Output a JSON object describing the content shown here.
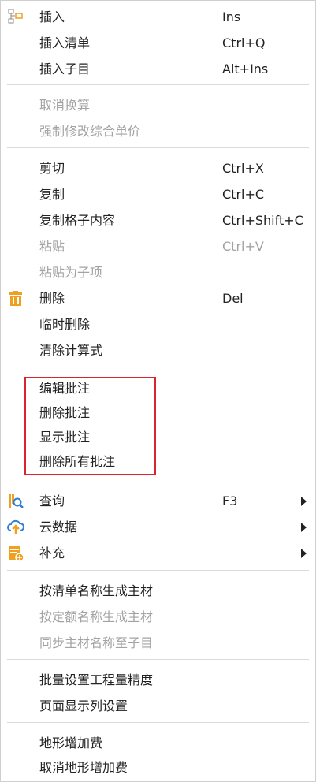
{
  "menu": {
    "insert": {
      "label": "插入",
      "shortcut": "Ins"
    },
    "insert_list": {
      "label": "插入清单",
      "shortcut": "Ctrl+Q"
    },
    "insert_child": {
      "label": "插入子目",
      "shortcut": "Alt+Ins"
    },
    "cancel_convert": {
      "label": "取消换算"
    },
    "force_modify_price": {
      "label": "强制修改综合单价"
    },
    "cut": {
      "label": "剪切",
      "shortcut": "Ctrl+X"
    },
    "copy": {
      "label": "复制",
      "shortcut": "Ctrl+C"
    },
    "copy_cell": {
      "label": "复制格子内容",
      "shortcut": "Ctrl+Shift+C"
    },
    "paste": {
      "label": "粘贴",
      "shortcut": "Ctrl+V"
    },
    "paste_as_child": {
      "label": "粘贴为子项"
    },
    "delete": {
      "label": "删除",
      "shortcut": "Del"
    },
    "temp_delete": {
      "label": "临时删除"
    },
    "clear_formula": {
      "label": "清除计算式"
    },
    "edit_note": {
      "label": "编辑批注"
    },
    "delete_note": {
      "label": "删除批注"
    },
    "show_note": {
      "label": "显示批注"
    },
    "delete_all_notes": {
      "label": "删除所有批注"
    },
    "query": {
      "label": "查询",
      "shortcut": "F3"
    },
    "cloud_data": {
      "label": "云数据"
    },
    "supplement": {
      "label": "补充"
    },
    "gen_main_by_list": {
      "label": "按清单名称生成主材"
    },
    "gen_main_by_quota": {
      "label": "按定额名称生成主材"
    },
    "sync_main_name": {
      "label": "同步主材名称至子目"
    },
    "batch_precision": {
      "label": "批量设置工程量精度"
    },
    "page_columns": {
      "label": "页面显示列设置"
    },
    "terrain_fee": {
      "label": "地形增加费"
    },
    "cancel_terrain_fee": {
      "label": "取消地形增加费"
    }
  },
  "colors": {
    "highlight_border": "#d9242f",
    "icon_orange": "#f0a020",
    "icon_blue": "#2e7fd8"
  },
  "icons": {
    "insert": "insert-tree-icon",
    "delete": "trash-icon",
    "query": "search-icon",
    "cloud_data": "cloud-upload-icon",
    "supplement": "supplement-icon"
  }
}
